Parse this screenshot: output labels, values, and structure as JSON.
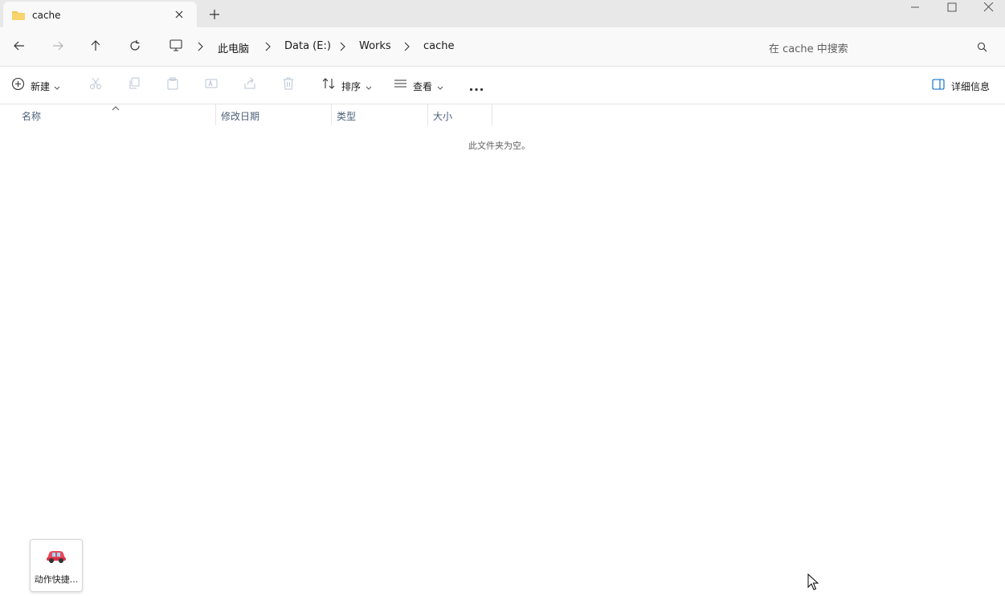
{
  "tab": {
    "title": "cache",
    "icon": "folder-icon"
  },
  "window_controls": [
    "minimize-icon",
    "maximize-icon",
    "close-icon"
  ],
  "nav": {
    "breadcrumb": [
      "此电脑",
      "Data (E:)",
      "Works",
      "cache"
    ],
    "search_placeholder": "在 cache 中搜索"
  },
  "toolbar": {
    "new_label": "新建",
    "sort_label": "排序",
    "view_label": "查看",
    "details_label": "详细信息"
  },
  "columns": [
    "名称",
    "修改日期",
    "类型",
    "大小"
  ],
  "empty_message": "此文件夹为空。",
  "desktop_shortcut": {
    "label": "动作快捷..."
  },
  "colors": {
    "accent": "#0067c0",
    "folder": "#f2c55c"
  }
}
